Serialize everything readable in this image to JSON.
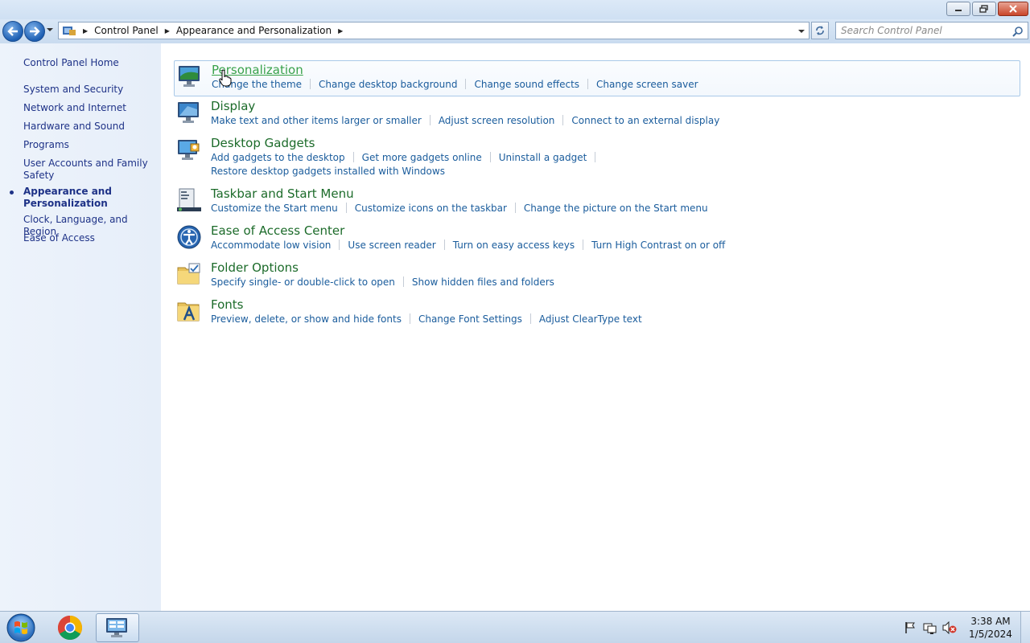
{
  "address": {
    "crumbs": [
      "Control Panel",
      "Appearance and Personalization"
    ]
  },
  "search": {
    "placeholder": "Search Control Panel"
  },
  "sidebar": {
    "home": "Control Panel Home",
    "items": [
      {
        "label": "System and Security"
      },
      {
        "label": "Network and Internet"
      },
      {
        "label": "Hardware and Sound"
      },
      {
        "label": "Programs"
      },
      {
        "label": "User Accounts and Family Safety"
      },
      {
        "label": "Appearance and Personalization",
        "current": true
      },
      {
        "label": "Clock, Language, and Region"
      },
      {
        "label": "Ease of Access"
      }
    ]
  },
  "categories": [
    {
      "title": "Personalization",
      "links": [
        "Change the theme",
        "Change desktop background",
        "Change sound effects",
        "Change screen saver"
      ]
    },
    {
      "title": "Display",
      "links": [
        "Make text and other items larger or smaller",
        "Adjust screen resolution",
        "Connect to an external display"
      ]
    },
    {
      "title": "Desktop Gadgets",
      "links": [
        "Add gadgets to the desktop",
        "Get more gadgets online",
        "Uninstall a gadget"
      ],
      "links2": [
        "Restore desktop gadgets installed with Windows"
      ]
    },
    {
      "title": "Taskbar and Start Menu",
      "links": [
        "Customize the Start menu",
        "Customize icons on the taskbar",
        "Change the picture on the Start menu"
      ]
    },
    {
      "title": "Ease of Access Center",
      "links": [
        "Accommodate low vision",
        "Use screen reader",
        "Turn on easy access keys",
        "Turn High Contrast on or off"
      ]
    },
    {
      "title": "Folder Options",
      "links": [
        "Specify single- or double-click to open",
        "Show hidden files and folders"
      ]
    },
    {
      "title": "Fonts",
      "links": [
        "Preview, delete, or show and hide fonts",
        "Change Font Settings",
        "Adjust ClearType text"
      ]
    }
  ],
  "taskbar": {
    "clock_time": "3:38 AM",
    "clock_date": "1/5/2024",
    "apps": [
      "chrome-icon",
      "control-panel-icon"
    ]
  }
}
